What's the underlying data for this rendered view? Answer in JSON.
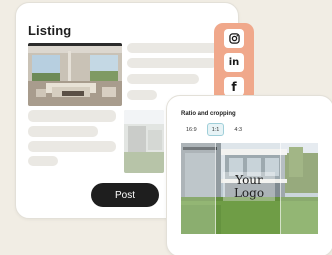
{
  "listing": {
    "title": "Listing",
    "post_label": "Post"
  },
  "social": {
    "items": [
      {
        "name": "instagram",
        "icon": "instagram-icon"
      },
      {
        "name": "linkedin",
        "icon": "linkedin-icon",
        "glyph": "in"
      },
      {
        "name": "facebook",
        "icon": "facebook-icon",
        "glyph": "f"
      }
    ],
    "strip_color": "#f0a88b"
  },
  "crop": {
    "title": "Ratio and cropping",
    "ratios": [
      "16:9",
      "1:1",
      "4:3"
    ],
    "selected_ratio": "1:1",
    "logo_text": "Your Logo"
  },
  "colors": {
    "background": "#f1ede4",
    "button": "#1e1e1e",
    "accent": "#f0a88b",
    "selected_chip": "#e7f3f6"
  }
}
